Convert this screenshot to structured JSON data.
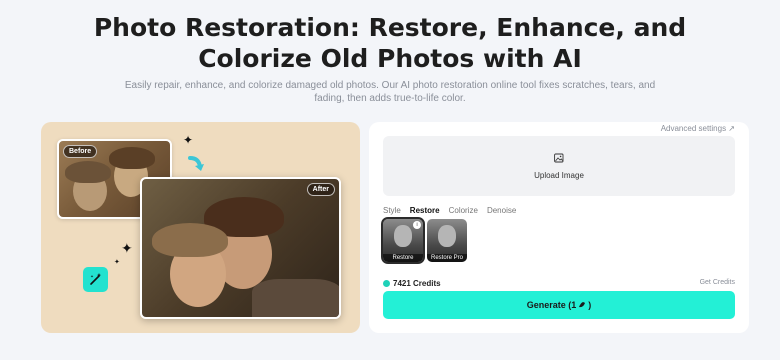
{
  "hero": {
    "title_line1": "Photo Restoration: Restore, Enhance, and",
    "title_line2": "Colorize Old Photos with AI",
    "subtitle_line1": "Easily repair, enhance, and colorize damaged old photos. Our AI photo restoration online tool fixes scratches, tears, and",
    "subtitle_line2": "fading, then adds true-to-life color."
  },
  "showcase": {
    "before_label": "Before",
    "after_label": "After",
    "icons": [
      "arrow-icon",
      "sparkle-icon",
      "magic-wand-icon"
    ]
  },
  "panel": {
    "advanced_settings": "Advanced settings ↗",
    "upload_label": "Upload Image",
    "tabs": [
      {
        "label": "Style",
        "active": false
      },
      {
        "label": "Restore",
        "active": true
      },
      {
        "label": "Colorize",
        "active": false
      },
      {
        "label": "Denoise",
        "active": false
      }
    ],
    "styles": [
      {
        "label": "Restore",
        "selected": true
      },
      {
        "label": "Restore Pro",
        "selected": false
      }
    ],
    "credits": "7421 Credits",
    "get_credits": "Get Credits",
    "generate_label": "Generate (1",
    "generate_suffix": ")"
  },
  "colors": {
    "accent": "#23f0d6",
    "showcase_bg": "#efdcbf",
    "page_bg": "#f3f5f9"
  }
}
